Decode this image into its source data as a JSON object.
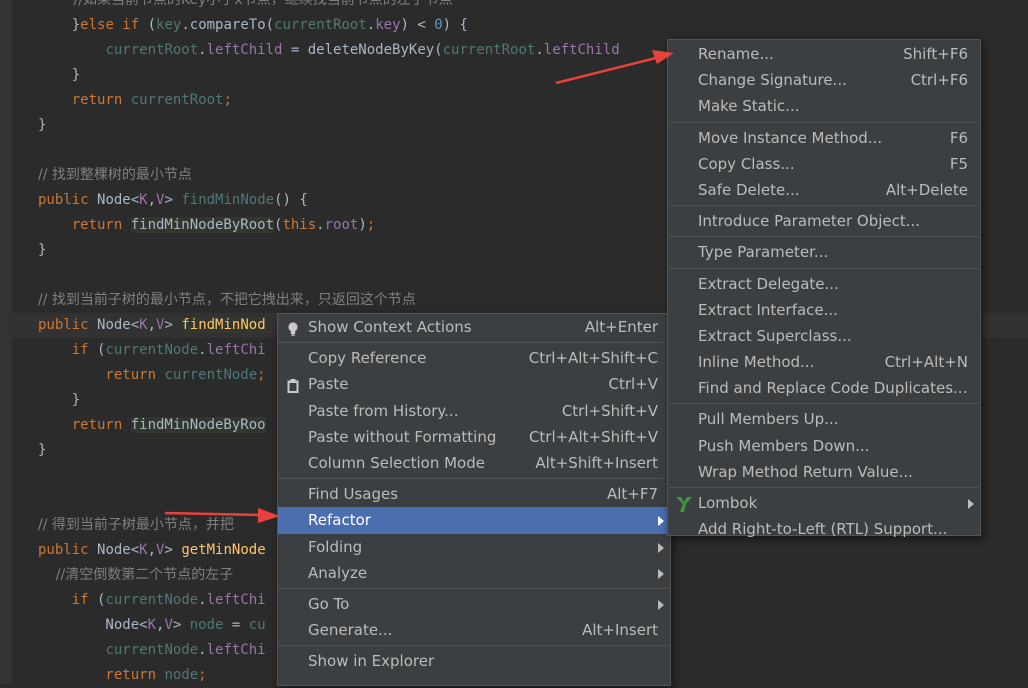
{
  "code_lines": [
    {
      "parts": [
        {
          "c": "c",
          "t": "        //如果当前节点的Key小于x节点，继续找当前节点的左子节点"
        }
      ]
    },
    {
      "parts": [
        {
          "c": "",
          "t": "    }"
        },
        {
          "c": "k",
          "t": "else if "
        },
        {
          "c": "",
          "t": "("
        },
        {
          "c": "tp",
          "t": "key"
        },
        {
          "c": "",
          "t": "."
        },
        {
          "c": "",
          "t": "compareTo("
        },
        {
          "c": "tp",
          "t": "currentRoot"
        },
        {
          "c": "",
          "t": "."
        },
        {
          "c": "f",
          "t": "key"
        },
        {
          "c": "",
          "t": ") < "
        },
        {
          "c": "n",
          "t": "0"
        },
        {
          "c": "",
          "t": ") {"
        }
      ]
    },
    {
      "parts": [
        {
          "c": "",
          "t": "        "
        },
        {
          "c": "tp",
          "t": "currentRoot"
        },
        {
          "c": "",
          "t": "."
        },
        {
          "c": "f",
          "t": "leftChild"
        },
        {
          "c": "",
          "t": " = deleteNodeByKey("
        },
        {
          "c": "tp",
          "t": "currentRoot"
        },
        {
          "c": "",
          "t": "."
        },
        {
          "c": "f",
          "t": "leftChild"
        }
      ]
    },
    {
      "parts": [
        {
          "c": "",
          "t": "    }"
        }
      ]
    },
    {
      "parts": [
        {
          "c": "k",
          "t": "    return "
        },
        {
          "c": "tp",
          "t": "currentRoot"
        },
        {
          "c": "k",
          "t": ";"
        }
      ]
    },
    {
      "parts": [
        {
          "c": "",
          "t": "}"
        }
      ]
    },
    {
      "parts": [
        {
          "c": "",
          "t": ""
        }
      ]
    },
    {
      "parts": [
        {
          "c": "c",
          "t": "// 找到整棵树的最小节点"
        }
      ]
    },
    {
      "parts": [
        {
          "c": "k",
          "t": "public "
        },
        {
          "c": "",
          "t": "Node<"
        },
        {
          "c": "fr",
          "t": "K"
        },
        {
          "c": "",
          "t": ","
        },
        {
          "c": "fr",
          "t": "V"
        },
        {
          "c": "",
          "t": "> "
        },
        {
          "c": "tp",
          "t": "findMinNode"
        },
        {
          "c": "",
          "t": "() {"
        }
      ]
    },
    {
      "parts": [
        {
          "c": "k",
          "t": "    return "
        },
        {
          "c": "hlm",
          "t": "findMinNodeByRoot"
        },
        {
          "c": "",
          "t": "("
        },
        {
          "c": "k",
          "t": "this"
        },
        {
          "c": "",
          "t": "."
        },
        {
          "c": "f",
          "t": "root"
        },
        {
          "c": "",
          "t": ")"
        },
        {
          "c": "k",
          "t": ";"
        }
      ]
    },
    {
      "parts": [
        {
          "c": "",
          "t": "}"
        }
      ]
    },
    {
      "parts": [
        {
          "c": "",
          "t": ""
        }
      ]
    },
    {
      "parts": [
        {
          "c": "c",
          "t": "// 找到当前子树的最小节点，不把它拽出来，只返回这个节点"
        }
      ]
    },
    {
      "parts": [
        {
          "c": "k",
          "t": "public "
        },
        {
          "c": "",
          "t": "Node<"
        },
        {
          "c": "fr",
          "t": "K"
        },
        {
          "c": "",
          "t": ","
        },
        {
          "c": "fr",
          "t": "V"
        },
        {
          "c": "",
          "t": "> "
        },
        {
          "c": "m hlm",
          "t": "findMinNod"
        }
      ],
      "highlight": true
    },
    {
      "parts": [
        {
          "c": "k",
          "t": "    if "
        },
        {
          "c": "",
          "t": "("
        },
        {
          "c": "tp",
          "t": "currentNode"
        },
        {
          "c": "",
          "t": "."
        },
        {
          "c": "f",
          "t": "leftChi"
        }
      ]
    },
    {
      "parts": [
        {
          "c": "k",
          "t": "        return "
        },
        {
          "c": "tp",
          "t": "currentNode"
        },
        {
          "c": "k",
          "t": ";"
        }
      ]
    },
    {
      "parts": [
        {
          "c": "",
          "t": "    }"
        }
      ]
    },
    {
      "parts": [
        {
          "c": "k",
          "t": "    return "
        },
        {
          "c": "hlm",
          "t": "findMinNodeByRoo"
        }
      ]
    },
    {
      "parts": [
        {
          "c": "",
          "t": "}"
        }
      ]
    },
    {
      "parts": [
        {
          "c": "",
          "t": ""
        }
      ]
    },
    {
      "parts": [
        {
          "c": "",
          "t": ""
        }
      ]
    },
    {
      "parts": [
        {
          "c": "c",
          "t": "// 得到当前子树最小节点，并把"
        }
      ]
    },
    {
      "parts": [
        {
          "c": "k",
          "t": "public "
        },
        {
          "c": "",
          "t": "Node<"
        },
        {
          "c": "fr",
          "t": "K"
        },
        {
          "c": "",
          "t": ","
        },
        {
          "c": "fr",
          "t": "V"
        },
        {
          "c": "",
          "t": "> "
        },
        {
          "c": "m",
          "t": "getMinNode"
        }
      ]
    },
    {
      "parts": [
        {
          "c": "c",
          "t": "    //清空倒数第二个节点的左子"
        }
      ]
    },
    {
      "parts": [
        {
          "c": "k",
          "t": "    if "
        },
        {
          "c": "",
          "t": "("
        },
        {
          "c": "tp",
          "t": "currentNode"
        },
        {
          "c": "",
          "t": "."
        },
        {
          "c": "f",
          "t": "leftChi"
        }
      ]
    },
    {
      "parts": [
        {
          "c": "",
          "t": "        Node<"
        },
        {
          "c": "fr",
          "t": "K"
        },
        {
          "c": "",
          "t": ","
        },
        {
          "c": "fr",
          "t": "V"
        },
        {
          "c": "",
          "t": "> "
        },
        {
          "c": "tp",
          "t": "node"
        },
        {
          "c": "",
          "t": " = "
        },
        {
          "c": "tp",
          "t": "cu"
        }
      ]
    },
    {
      "parts": [
        {
          "c": "",
          "t": "        "
        },
        {
          "c": "tp",
          "t": "currentNode"
        },
        {
          "c": "",
          "t": "."
        },
        {
          "c": "f",
          "t": "leftChi"
        }
      ]
    },
    {
      "parts": [
        {
          "c": "k",
          "t": "        return "
        },
        {
          "c": "tp",
          "t": "node"
        },
        {
          "c": "k",
          "t": ";"
        }
      ]
    }
  ],
  "context_menu": {
    "groups": [
      [
        {
          "label": "Show Context Actions",
          "shortcut": "Alt+Enter",
          "icon": "lightbulb-icon"
        }
      ],
      [
        {
          "label": "Copy Reference",
          "shortcut": "Ctrl+Alt+Shift+C"
        },
        {
          "label": "Paste",
          "shortcut": "Ctrl+V",
          "icon": "clipboard-icon"
        },
        {
          "label": "Paste from History...",
          "shortcut": "Ctrl+Shift+V"
        },
        {
          "label": "Paste without Formatting",
          "shortcut": "Ctrl+Alt+Shift+V"
        },
        {
          "label": "Column Selection Mode",
          "shortcut": "Alt+Shift+Insert"
        }
      ],
      [
        {
          "label": "Find Usages",
          "shortcut": "Alt+F7"
        },
        {
          "label": "Refactor",
          "shortcut": "",
          "submenu": true,
          "active": true
        },
        {
          "label": "Folding",
          "shortcut": "",
          "submenu": true
        },
        {
          "label": "Analyze",
          "shortcut": "",
          "submenu": true
        }
      ],
      [
        {
          "label": "Go To",
          "shortcut": "",
          "submenu": true
        },
        {
          "label": "Generate...",
          "shortcut": "Alt+Insert"
        }
      ],
      [
        {
          "label": "Show in Explorer",
          "shortcut": ""
        }
      ]
    ]
  },
  "refactor_menu": {
    "groups": [
      [
        {
          "label": "Rename...",
          "shortcut": "Shift+F6"
        },
        {
          "label": "Change Signature...",
          "shortcut": "Ctrl+F6"
        },
        {
          "label": "Make Static...",
          "shortcut": ""
        }
      ],
      [
        {
          "label": "Move Instance Method...",
          "shortcut": "F6"
        },
        {
          "label": "Copy Class...",
          "shortcut": "F5"
        },
        {
          "label": "Safe Delete...",
          "shortcut": "Alt+Delete"
        }
      ],
      [
        {
          "label": "Introduce Parameter Object...",
          "shortcut": ""
        }
      ],
      [
        {
          "label": "Type Parameter...",
          "shortcut": ""
        }
      ],
      [
        {
          "label": "Extract Delegate...",
          "shortcut": ""
        },
        {
          "label": "Extract Interface...",
          "shortcut": ""
        },
        {
          "label": "Extract Superclass...",
          "shortcut": ""
        },
        {
          "label": "Inline Method...",
          "shortcut": "Ctrl+Alt+N"
        },
        {
          "label": "Find and Replace Code Duplicates...",
          "shortcut": ""
        }
      ],
      [
        {
          "label": "Pull Members Up...",
          "shortcut": ""
        },
        {
          "label": "Push Members Down...",
          "shortcut": ""
        },
        {
          "label": "Wrap Method Return Value...",
          "shortcut": ""
        }
      ],
      [
        {
          "label": "Lombok",
          "shortcut": "",
          "submenu": true,
          "icon": "lombok-icon"
        },
        {
          "label": "Add Right-to-Left (RTL) Support...",
          "shortcut": ""
        }
      ]
    ]
  },
  "colors": {
    "editor_bg": "#2b2b2b",
    "menu_bg": "#3c3f41",
    "menu_active": "#4b6eaf",
    "annotation_arrow": "#e8423f"
  }
}
